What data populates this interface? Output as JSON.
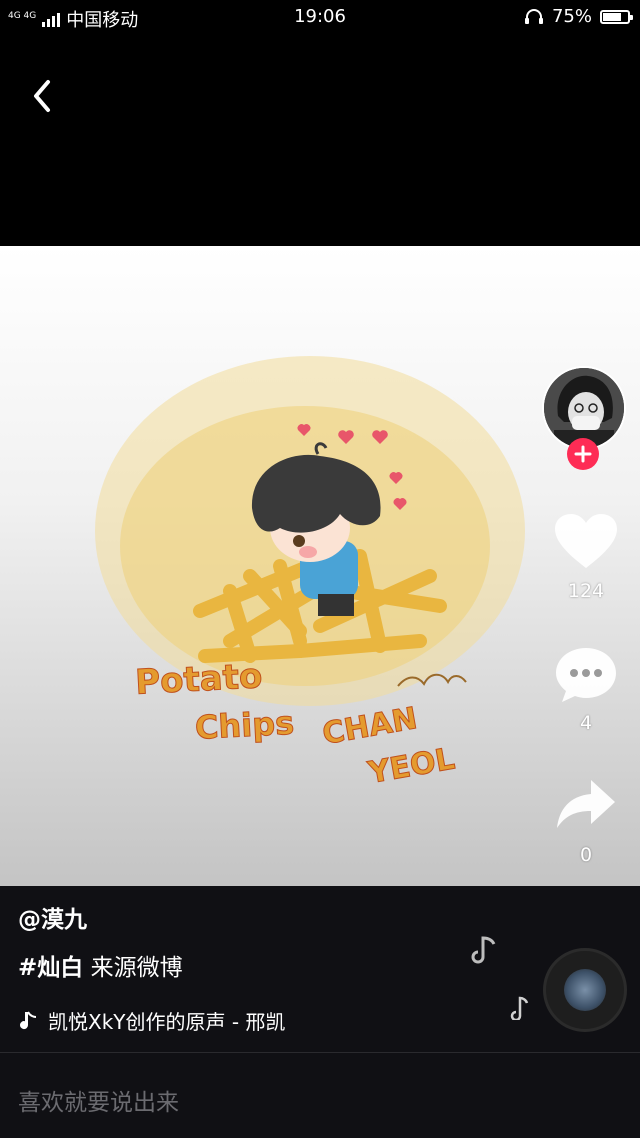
{
  "status": {
    "network": "4G 4G",
    "carrier": "中国移动",
    "time": "19:06",
    "battery_percent": 75
  },
  "artwork": {
    "text_potato": "Potato",
    "text_chips": "Chips",
    "text_chan": "CHAN",
    "text_yeol": "YEOL"
  },
  "actions": {
    "likes": "124",
    "comments": "4",
    "shares": "0"
  },
  "post": {
    "author": "@漠九",
    "hashtag": "#灿白",
    "caption": "来源微博",
    "music": "凯悦XkY创作的原声 - 邢凯"
  },
  "comment_box": {
    "placeholder": "喜欢就要说出来"
  },
  "colors": {
    "follow": "#fe2c55",
    "background": "#000000",
    "panel": "#101014"
  },
  "icons": [
    "back-chevron-icon",
    "heart-icon",
    "comment-bubble-icon",
    "share-arrow-icon",
    "plus-icon",
    "music-note-icon",
    "headset-icon"
  ]
}
